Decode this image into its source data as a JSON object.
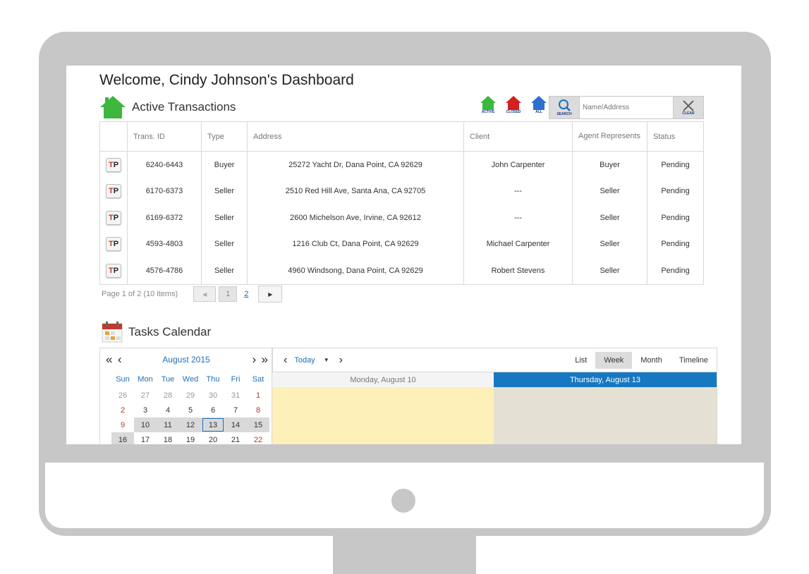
{
  "welcome": "Welcome, Cindy Johnson's Dashboard",
  "active_transactions": {
    "title": "Active Transactions",
    "filters": [
      {
        "label": "ACTIVE",
        "color": "#3cb83c"
      },
      {
        "label": "CLOSED",
        "color": "#d42020"
      },
      {
        "label": "ALL",
        "color": "#2d6fd0"
      }
    ],
    "search_label": "SEARCH",
    "search_placeholder": "Name/Address",
    "clear_label": "CLEAR",
    "columns": [
      "Trans. ID",
      "Type",
      "Address",
      "Client",
      "Agent Represents",
      "Status"
    ],
    "icon_letters": {
      "t": "T",
      "p": "P"
    },
    "rows": [
      {
        "id": "6240-6443",
        "type": "Buyer",
        "address": "25272 Yacht Dr, Dana Point, CA 92629",
        "client": "John Carpenter",
        "agent": "Buyer",
        "status": "Pending"
      },
      {
        "id": "6170-6373",
        "type": "Seller",
        "address": "2510 Red Hill Ave, Santa Ana, CA 92705",
        "client": "---",
        "agent": "Seller",
        "status": "Pending"
      },
      {
        "id": "6169-6372",
        "type": "Seller",
        "address": "2600 Michelson Ave, Irvine, CA 92612",
        "client": "---",
        "agent": "Seller",
        "status": "Pending"
      },
      {
        "id": "4593-4803",
        "type": "Seller",
        "address": "1216 Club Ct, Dana Point, CA 92629",
        "client": "Michael Carpenter",
        "agent": "Seller",
        "status": "Pending"
      },
      {
        "id": "4576-4786",
        "type": "Seller",
        "address": "4960 Windsong, Dana Point, CA 92629",
        "client": "Robert Stevens",
        "agent": "Seller",
        "status": "Pending"
      }
    ]
  },
  "pager": {
    "info": "Page 1 of 2 (10 items)",
    "current": "1",
    "next_page": "2"
  },
  "tasks_calendar": {
    "title": "Tasks Calendar",
    "mini": {
      "month": "August 2015",
      "weekdays": [
        "Sun",
        "Mon",
        "Tue",
        "Wed",
        "Thu",
        "Fri",
        "Sat"
      ],
      "weeks": [
        [
          "26",
          "27",
          "28",
          "29",
          "30",
          "31",
          "1"
        ],
        [
          "2",
          "3",
          "4",
          "5",
          "6",
          "7",
          "8"
        ],
        [
          "9",
          "10",
          "11",
          "12",
          "13",
          "14",
          "15"
        ],
        [
          "16",
          "17",
          "18",
          "19",
          "20",
          "21",
          "22"
        ]
      ]
    },
    "toolbar": {
      "today": "Today",
      "views": [
        "List",
        "Week",
        "Month",
        "Timeline"
      ],
      "active_view": "Week"
    },
    "day_headers": [
      "Monday, August 10",
      "Thursday, August 13"
    ],
    "colors": {
      "accent": "#1778c2",
      "day_a": "#fdf0b8",
      "day_b": "#e4e1d4"
    }
  }
}
